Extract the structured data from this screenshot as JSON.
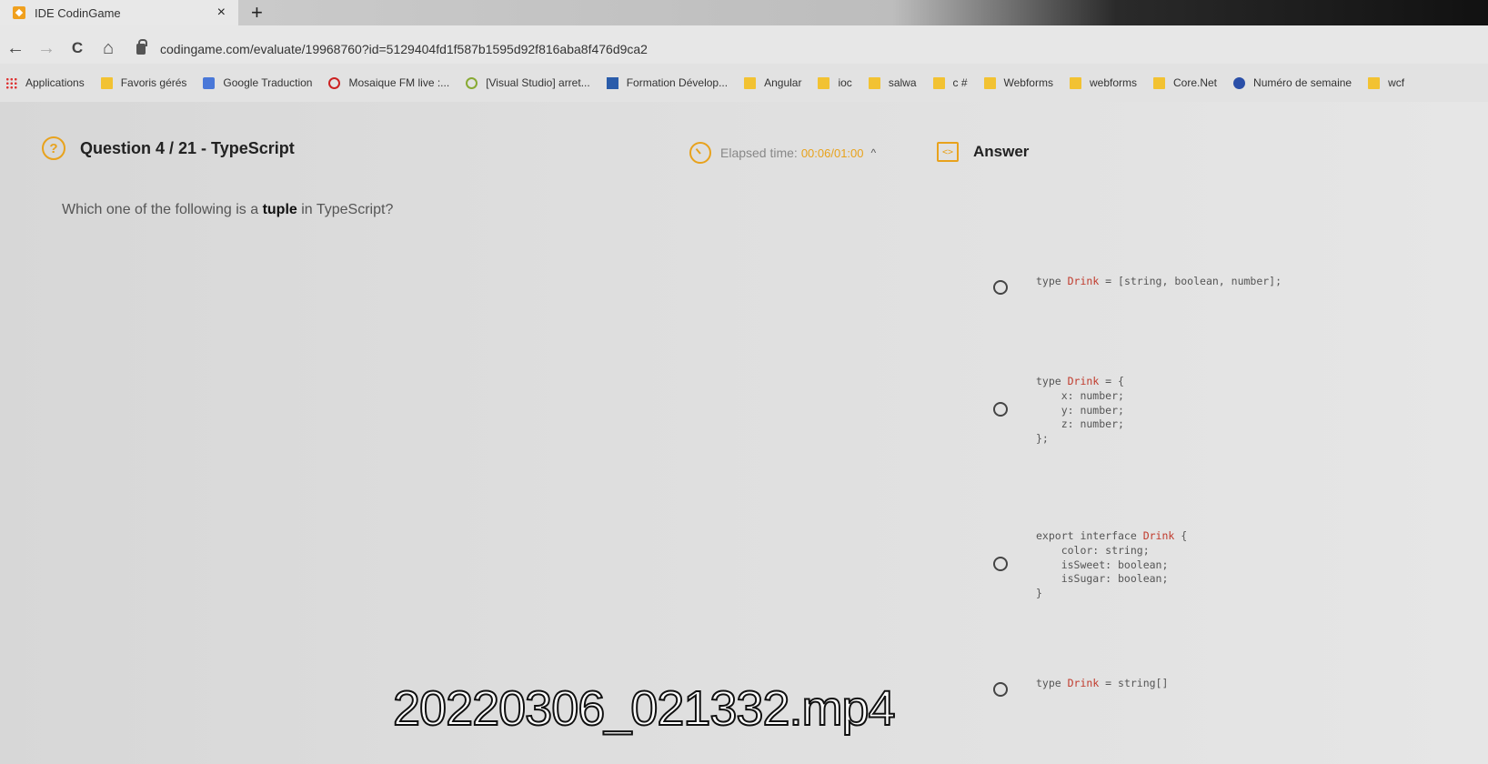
{
  "browser": {
    "tab_title": "IDE CodinGame",
    "tab_close": "×",
    "new_tab": "+",
    "url": "codingame.com/evaluate/19968760?id=5129404fd1f587b1595d92f816aba8f476d9ca2",
    "nav": {
      "back": "←",
      "forward": "→",
      "reload": "C",
      "home": "⌂"
    },
    "bookmarks": [
      {
        "label": "Applications",
        "icon": "apps-icon"
      },
      {
        "label": "Favoris gérés",
        "icon": "folder-icon"
      },
      {
        "label": "Google Traduction",
        "icon": "translate-icon"
      },
      {
        "label": "Mosaique FM live :...",
        "icon": "mosaique-icon"
      },
      {
        "label": "[Visual Studio] arret...",
        "icon": "search-icon"
      },
      {
        "label": "Formation Dévelop...",
        "icon": "formation-icon"
      },
      {
        "label": "Angular",
        "icon": "folder-icon"
      },
      {
        "label": "ioc",
        "icon": "folder-icon"
      },
      {
        "label": "salwa",
        "icon": "folder-icon"
      },
      {
        "label": "c #",
        "icon": "folder-icon"
      },
      {
        "label": "Webforms",
        "icon": "folder-icon"
      },
      {
        "label": "webforms",
        "icon": "folder-icon"
      },
      {
        "label": "Core.Net",
        "icon": "folder-icon"
      },
      {
        "label": "Numéro de semaine",
        "icon": "calendar-icon"
      },
      {
        "label": "wcf",
        "icon": "folder-icon"
      }
    ]
  },
  "question": {
    "help_glyph": "?",
    "title": "Question 4 / 21 - TypeScript",
    "elapsed_label": "Elapsed time:",
    "elapsed_value": "00:06/01:00",
    "toggle_glyph": "^",
    "answer_glyph": "<>",
    "answer_label": "Answer",
    "prompt_before": "Which one of the following is a",
    "prompt_bold": "tuple",
    "prompt_after": "in TypeScript?"
  },
  "options": [
    [
      "type Drink = [string, boolean, number];"
    ],
    [
      "type Drink = {",
      "    x: number;",
      "    y: number;",
      "    z: number;",
      "};"
    ],
    [
      "export interface Drink {",
      "    color: string;",
      "    isSweet: boolean;",
      "    isSugar: boolean;",
      "}"
    ],
    [
      "type Drink = string[]"
    ]
  ],
  "overlay": {
    "filename": "20220306_021332.mp4"
  },
  "colors": {
    "accent": "#e8a21c",
    "type_name": "#c0392b"
  }
}
